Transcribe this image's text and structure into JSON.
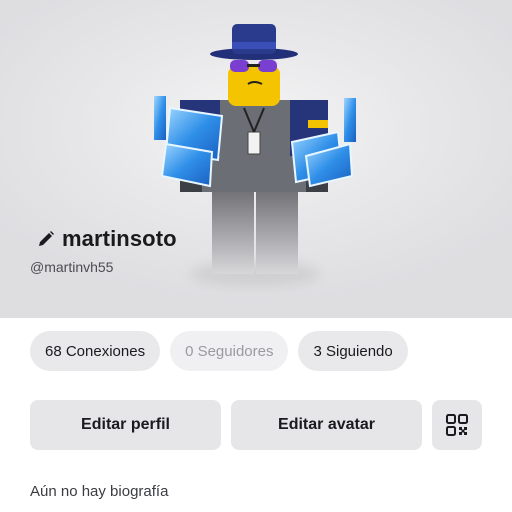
{
  "profile": {
    "display_name": "martinsoto",
    "username": "@martinvh55"
  },
  "stats": {
    "connections": "68 Conexiones",
    "followers": "0 Seguidores",
    "following": "3 Siguiendo"
  },
  "actions": {
    "edit_profile": "Editar perfil",
    "edit_avatar": "Editar avatar",
    "qr_icon": "qr-code-icon"
  },
  "bio": {
    "text": "Aún no hay biografía"
  },
  "colors": {
    "pill_bg": "#e9e9eb",
    "button_bg": "#e6e6e8",
    "text_primary": "#1b1b1f",
    "text_muted": "#9a9aa0",
    "avatar_hat": "#2a3a8c",
    "avatar_skin": "#f5c400",
    "avatar_cards": "#3aa0f0"
  }
}
